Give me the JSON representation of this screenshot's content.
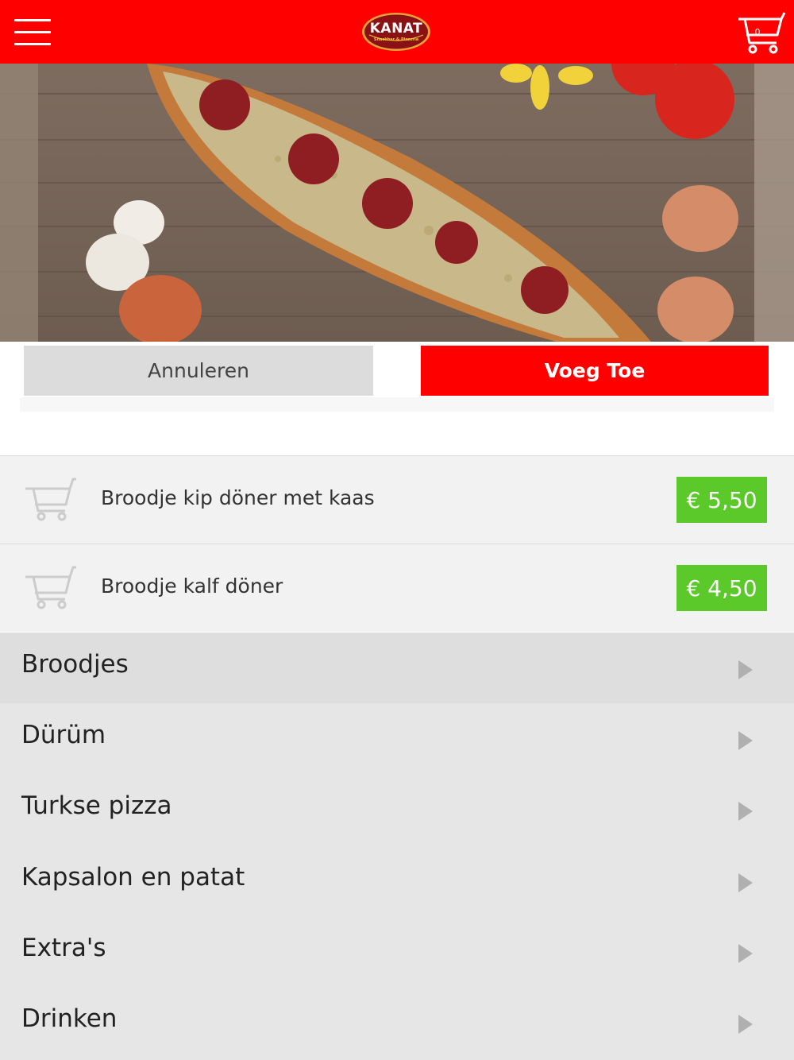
{
  "header": {
    "logo_text": "KANAT",
    "logo_subtext": "Snackbar & Pizzeria",
    "cart_count": "0",
    "colors": {
      "bar": "#ff0000"
    }
  },
  "hero": {
    "image": "pide-with-sucuk-on-wooden-table"
  },
  "actions": {
    "cancel_label": "Annuleren",
    "add_label": "Voeg Toe"
  },
  "products": [
    {
      "name": "Broodje kip döner met kaas",
      "price": "€ 5,50",
      "icon": "cart-icon"
    },
    {
      "name": "Broodje kalf döner",
      "price": "€ 4,50",
      "icon": "cart-icon"
    }
  ],
  "categories": [
    {
      "label": "Broodjes"
    },
    {
      "label": "Dürüm"
    },
    {
      "label": "Turkse pizza"
    },
    {
      "label": "Kapsalon en patat"
    },
    {
      "label": "Extra's"
    },
    {
      "label": "Drinken"
    }
  ],
  "colors": {
    "accent": "#ff0000",
    "price_badge": "#5cc92a",
    "cancel_button": "#dcdcdc"
  }
}
